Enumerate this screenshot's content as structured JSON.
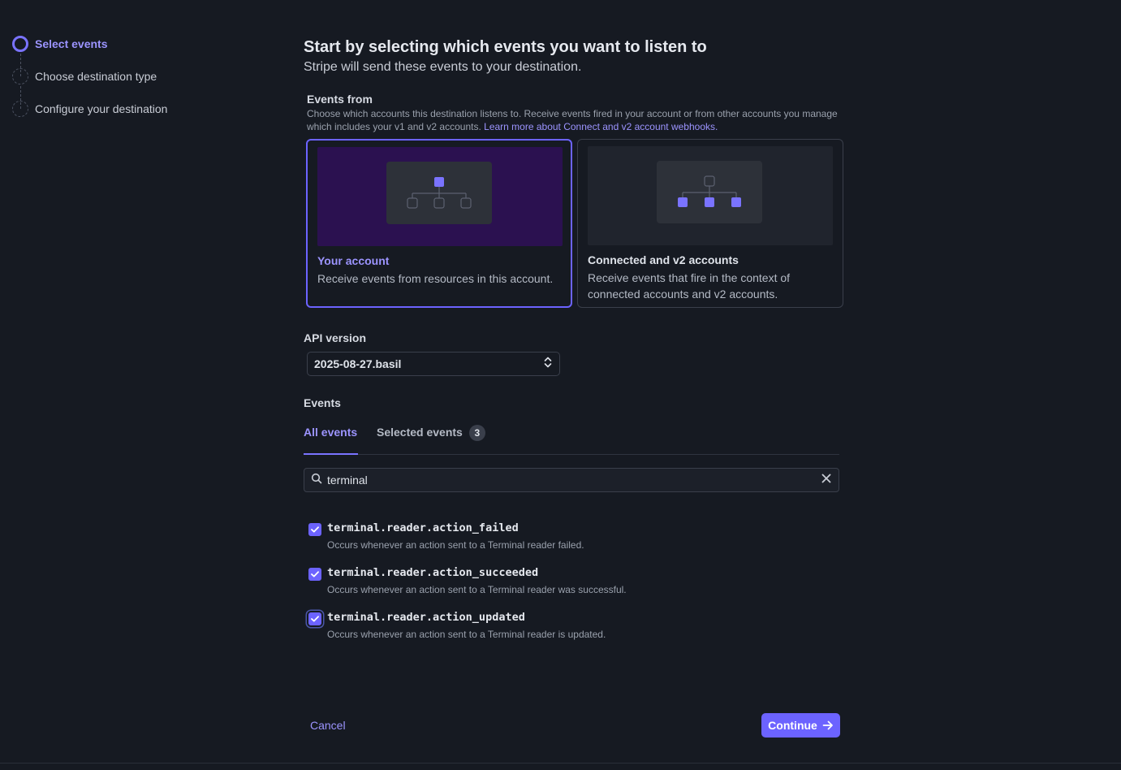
{
  "stepper": {
    "steps": [
      {
        "label": "Select events",
        "active": true
      },
      {
        "label": "Choose destination type",
        "active": false
      },
      {
        "label": "Configure your destination",
        "active": false
      }
    ]
  },
  "header": {
    "title": "Start by selecting which events you want to listen to",
    "subtitle": "Stripe will send these events to your destination."
  },
  "events_from": {
    "label": "Events from",
    "description": "Choose which accounts this destination listens to. Receive events fired in your account or from other accounts you manage which includes your v1 and v2 accounts.",
    "link_text": "Learn more about Connect and v2 account webhooks.",
    "options": [
      {
        "title": "Your account",
        "description": "Receive events from resources in this account.",
        "selected": true
      },
      {
        "title": "Connected and v2 accounts",
        "description": "Receive events that fire in the context of connected accounts and v2 accounts.",
        "selected": false
      }
    ]
  },
  "api_version": {
    "label": "API version",
    "value": "2025-08-27.basil"
  },
  "events": {
    "label": "Events",
    "tabs": [
      {
        "label": "All events",
        "active": true
      },
      {
        "label": "Selected events",
        "badge": "3",
        "active": false
      }
    ],
    "search_value": "terminal",
    "list": [
      {
        "name": "terminal.reader.action_failed",
        "description": "Occurs whenever an action sent to a Terminal reader failed.",
        "checked": true
      },
      {
        "name": "terminal.reader.action_succeeded",
        "description": "Occurs whenever an action sent to a Terminal reader was successful.",
        "checked": true
      },
      {
        "name": "terminal.reader.action_updated",
        "description": "Occurs whenever an action sent to a Terminal reader is updated.",
        "checked": true
      }
    ]
  },
  "footer": {
    "cancel_label": "Cancel",
    "continue_label": "Continue"
  },
  "colors": {
    "accent": "#6c63ff",
    "accent_text": "#9c94ff",
    "background": "#161a22"
  }
}
